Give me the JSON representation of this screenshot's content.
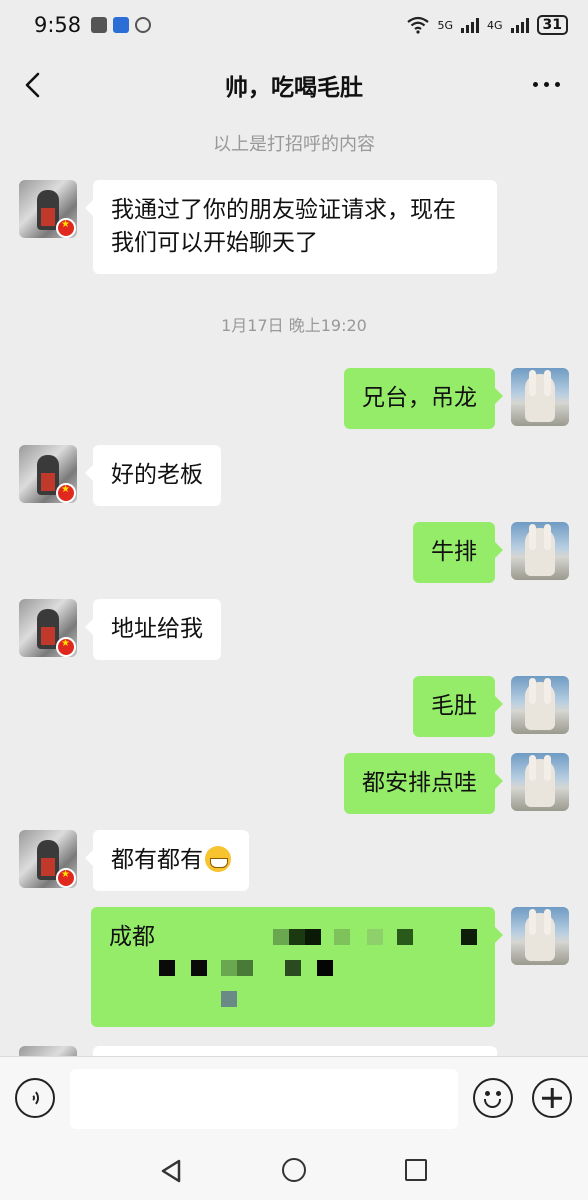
{
  "status_bar": {
    "time": "9:58",
    "network_1": "5G",
    "network_2": "4G",
    "battery": "31"
  },
  "header": {
    "title": "帅，吃喝毛肚"
  },
  "chat": {
    "system_notice": "以上是打招呼的内容",
    "timestamp": "1月17日 晚上19:20",
    "messages": [
      {
        "side": "left",
        "text": "我通过了你的朋友验证请求，现在\n我们可以开始聊天了"
      },
      {
        "side": "right",
        "text": "兄台，吊龙"
      },
      {
        "side": "left",
        "text": "好的老板"
      },
      {
        "side": "right",
        "text": "牛排"
      },
      {
        "side": "left",
        "text": "地址给我"
      },
      {
        "side": "right",
        "text": "毛肚"
      },
      {
        "side": "right",
        "text": "都安排点哇"
      },
      {
        "side": "left",
        "text": "都有都有",
        "emoji": "grinning-face"
      },
      {
        "side": "right",
        "text": "成都",
        "redacted": true
      }
    ]
  },
  "colors": {
    "background": "#ededed",
    "bubble_self": "#95ec69",
    "bubble_other": "#ffffff"
  }
}
